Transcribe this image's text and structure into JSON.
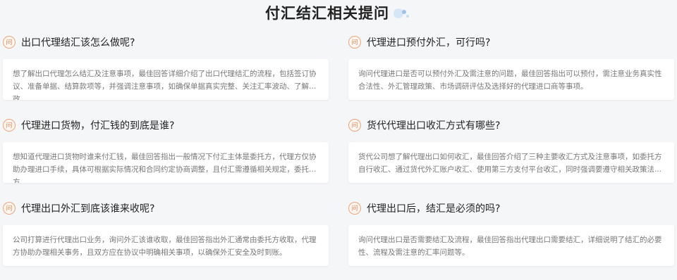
{
  "page": {
    "title": "付汇结汇相关提问"
  },
  "cards": [
    {
      "icon_label": "问",
      "question": "出口代理结汇该怎么做呢?",
      "answer": "想了解出口代理怎么结汇及注意事项，最佳回答详细介绍了出口代理结汇的流程，包括签订协议、准备单据、结算款项等，并强调注意事项，如确保单据真实完整、关注汇率波动、了解政..."
    },
    {
      "icon_label": "问",
      "question": "代理进口预付外汇，可行吗?",
      "answer": "询问代理进口是否可以预付外汇及需注意的问题，最佳回答指出可以预付，需注意业务真实性合法性、外汇管理政策、市场调研评估及选择好的代理进口商等事项。"
    },
    {
      "icon_label": "问",
      "question": "代理进口货物，付汇钱的到底是谁?",
      "answer": "想知道代理进口货物时谁来付汇钱，最佳回答指出一般情况下付汇主体是委托方，代理方仅协助办理进口手续，具体可根据实际情况和合同约定协商调整，且付汇需遵循相关规定，委托方..."
    },
    {
      "icon_label": "问",
      "question": "货代代理出口收汇方式有哪些?",
      "answer": "货代公司想了解代理出口如何收汇，最佳回答介绍了三种主要收汇方式及注意事项，如委托方自行收汇、通过货代外汇账户收汇、使用第三方支付平台收汇，同时强调要遵守相关政策法..."
    },
    {
      "icon_label": "问",
      "question": "代理出口外汇到底该谁来收呢?",
      "answer": "公司打算进行代理出口业务，询问外汇该谁收取，最佳回答指出外汇通常由委托方收取，代理方协助办理相关事务，且双方应在协议中明确相关事项，以确保外汇安全及时到账。"
    },
    {
      "icon_label": "问",
      "question": "代理出口后，结汇是必须的吗?",
      "answer": "询问代理出口是否需要结汇及流程，最佳回答指出代理出口需要结汇，详细说明了结汇的必要性、流程及需注意的汇率问题等。"
    }
  ]
}
